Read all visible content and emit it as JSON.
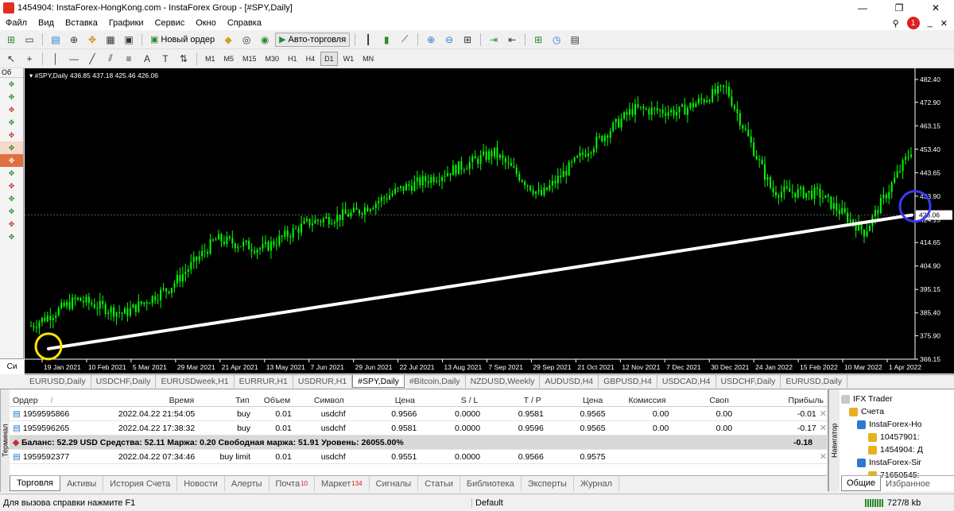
{
  "window": {
    "title": "1454904: InstaForex-HongKong.com - InstaForex Group - [#SPY,Daily]",
    "min": "—",
    "max": "❐",
    "close": "✕"
  },
  "menu": [
    "Файл",
    "Вид",
    "Вставка",
    "Графики",
    "Сервис",
    "Окно",
    "Справка"
  ],
  "menu_right": {
    "notifications": "1"
  },
  "toolbar": {
    "new_order": "Новый ордер",
    "auto_trading": "Авто-торговля"
  },
  "timeframes": [
    "M1",
    "M5",
    "M15",
    "M30",
    "H1",
    "H4",
    "D1",
    "W1",
    "MN"
  ],
  "active_timeframe": "D1",
  "left_panel": {
    "header": "Об",
    "bottom_label": "Си"
  },
  "chart": {
    "header": "#SPY,Daily  436.85 437.18 425.46 426.06",
    "price_labels": [
      "482.40",
      "472.90",
      "463.15",
      "453.40",
      "443.65",
      "433.90",
      "424.15",
      "414.65",
      "404.90",
      "395.15",
      "385.40",
      "375.90",
      "366.15"
    ],
    "current_price": "426.06",
    "date_labels": [
      "19 Jan 2021",
      "10 Feb 2021",
      "5 Mar 2021",
      "29 Mar 2021",
      "21 Apr 2021",
      "13 May 2021",
      "7 Jun 2021",
      "29 Jun 2021",
      "22 Jul 2021",
      "13 Aug 2021",
      "7 Sep 2021",
      "29 Sep 2021",
      "21 Oct 2021",
      "12 Nov 2021",
      "7 Dec 2021",
      "30 Dec 2021",
      "24 Jan 2022",
      "15 Feb 2022",
      "10 Mar 2022",
      "1 Apr 2022"
    ],
    "colors": {
      "bg": "#000000",
      "candles": "#00ff00",
      "trendline": "#ffffff",
      "circle_start": "#ffe600",
      "circle_end": "#3a3aff"
    }
  },
  "chart_data": {
    "type": "line",
    "x": [
      "19 Jan 2021",
      "10 Feb 2021",
      "5 Mar 2021",
      "29 Mar 2021",
      "21 Apr 2021",
      "13 May 2021",
      "7 Jun 2021",
      "29 Jun 2021",
      "22 Jul 2021",
      "13 Aug 2021",
      "7 Sep 2021",
      "29 Sep 2021",
      "21 Oct 2021",
      "12 Nov 2021",
      "7 Dec 2021",
      "30 Dec 2021",
      "24 Jan 2022",
      "15 Feb 2022",
      "10 Mar 2022",
      "1 Apr 2022"
    ],
    "series": [
      {
        "values": [
          380,
          391,
          385,
          396,
          416,
          412,
          423,
          427,
          437,
          444,
          452,
          434,
          453,
          470,
          469,
          479,
          436,
          435,
          419,
          453
        ]
      }
    ],
    "current": 426.06,
    "trendline": {
      "start_price": 370.5,
      "end_price": 426.06
    },
    "ylim": [
      366.15,
      482.4
    ],
    "grid": true
  },
  "chart_tabs": [
    "EURUSD,Daily",
    "USDCHF,Daily",
    "EURUSDweek,H1",
    "EURRUR,H1",
    "USDRUR,H1",
    "#SPY,Daily",
    "#Bitcoin,Daily",
    "NZDUSD,Weekly",
    "AUDUSD,H4",
    "GBPUSD,H4",
    "USDCAD,H4",
    "USDCHF,Daily",
    "EURUSD,Daily"
  ],
  "active_chart_tab": "#SPY,Daily",
  "terminal": {
    "side_label": "Терминал",
    "columns": [
      "Ордер",
      "/",
      "Время",
      "Тип",
      "Объем",
      "Символ",
      "Цена",
      "S / L",
      "T / P",
      "Цена",
      "Комиссия",
      "Своп",
      "Прибыль"
    ],
    "rows": [
      [
        "1959595866",
        "2022.04.22 21:54:05",
        "buy",
        "0.01",
        "usdchf",
        "0.9566",
        "0.0000",
        "0.9581",
        "0.9565",
        "0.00",
        "0.00",
        "-0.01"
      ],
      [
        "1959596265",
        "2022.04.22 17:38:32",
        "buy",
        "0.01",
        "usdchf",
        "0.9581",
        "0.0000",
        "0.9596",
        "0.9565",
        "0.00",
        "0.00",
        "-0.17"
      ]
    ],
    "balance": "Баланс: 52.29 USD  Средства: 52.11  Маржа: 0.20  Свободная маржа: 51.91  Уровень: 26055.00%",
    "balance_profit": "-0.18",
    "pending": [
      "1959592377",
      "2022.04.22 07:34:46",
      "buy limit",
      "0.01",
      "usdchf",
      "0.9551",
      "0.0000",
      "0.9566",
      "0.9575",
      "",
      "",
      ""
    ],
    "tabs": [
      "Торговля",
      "Активы",
      "История Счета",
      "Новости",
      "Алерты",
      "Почта",
      "Маркет",
      "Сигналы",
      "Статьи",
      "Библиотека",
      "Эксперты",
      "Журнал"
    ],
    "mail_count": "10",
    "market_count": "134"
  },
  "navigator": {
    "side_label": "Навигатор",
    "items": [
      "IFX Trader",
      "Счета",
      "InstaForex-Ho",
      "10457901:",
      "1454904: Д",
      "InstaForex-Sir",
      "71650545:"
    ],
    "tabs": [
      "Общие",
      "Избранное"
    ]
  },
  "status": {
    "help": "Для вызова справки нажмите F1",
    "profile": "Default",
    "traffic": "727/8 kb"
  }
}
